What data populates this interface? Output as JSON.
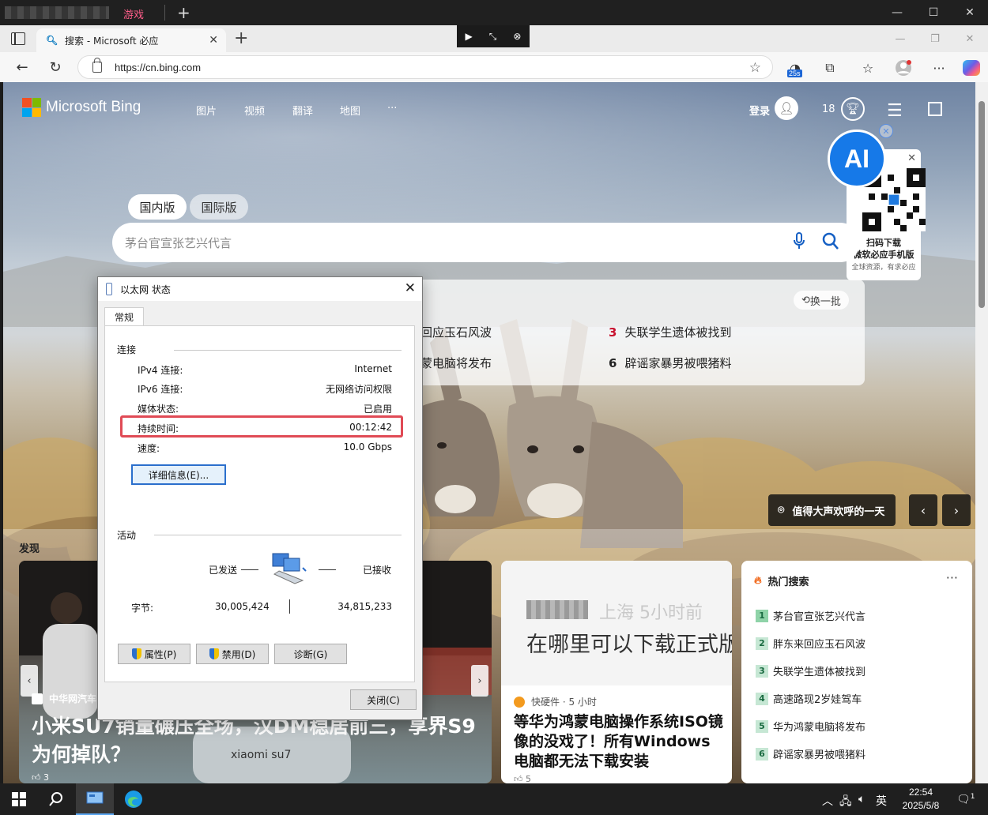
{
  "window": {
    "blurred_tab": "",
    "game_tab": "游戏"
  },
  "browser": {
    "tab_title": "搜索 - Microsoft 必应",
    "url": "https://cn.bing.com",
    "ext_badge": "25s"
  },
  "bing": {
    "brand": "Microsoft Bing",
    "nav": [
      "图片",
      "视频",
      "翻译",
      "地图",
      "···"
    ],
    "signin": "登录",
    "rewards": "18",
    "ai_badge": "AI",
    "qr_card": {
      "line1": "扫码下载",
      "line2": "微软必应手机版",
      "line3": "全球资源，有求必应"
    },
    "region_tabs": [
      "国内版",
      "国际版"
    ],
    "search_placeholder": "茅台官宣张艺兴代言",
    "trending_refresh": "换一批",
    "trending": [
      {
        "num": "",
        "text": "回应玉石风波"
      },
      {
        "num": "3",
        "text": "失联学生遗体被找到"
      },
      {
        "num": "",
        "text": "蒙电脑将发布"
      },
      {
        "num": "6",
        "text": "辟谣家暴男被喂猪料"
      }
    ],
    "caption": "值得大声欢呼的一天",
    "discover_label": "发现"
  },
  "cards": {
    "big": {
      "source": "中华网汽车",
      "headline": "小米SU7销量碾压全场，汉DM稳居前三，享界S9为何掉队？",
      "likes": "3"
    },
    "mid": {
      "meta": "上海 5小时前",
      "image_text": "在哪里可以下载正式版",
      "source": "快硬件 · 5 小时",
      "headline": "等华为鸿蒙电脑操作系统ISO镜像的没戏了！所有Windows电脑都无法下载安装",
      "likes": "5"
    },
    "hot": {
      "title": "热门搜索",
      "items": [
        {
          "n": "1",
          "text": "茅台官宣张艺兴代言"
        },
        {
          "n": "2",
          "text": "胖东来回应玉石风波"
        },
        {
          "n": "3",
          "text": "失联学生遗体被找到"
        },
        {
          "n": "4",
          "text": "高速路现2岁娃驾车"
        },
        {
          "n": "5",
          "text": "华为鸿蒙电脑将发布"
        },
        {
          "n": "6",
          "text": "辟谣家暴男被喂猪料"
        }
      ]
    }
  },
  "dialog": {
    "title": "以太网 状态",
    "tab": "常规",
    "group_connection": "连接",
    "rows": [
      {
        "label": "IPv4 连接:",
        "value": "Internet"
      },
      {
        "label": "IPv6 连接:",
        "value": "无网络访问权限"
      },
      {
        "label": "媒体状态:",
        "value": "已启用"
      },
      {
        "label": "持续时间:",
        "value": "00:12:42"
      },
      {
        "label": "速度:",
        "value": "10.0 Gbps"
      }
    ],
    "details_button": "详细信息(E)...",
    "group_activity": "活动",
    "sent_label": "已发送",
    "received_label": "已接收",
    "bytes_label": "字节:",
    "bytes_sent": "30,005,424",
    "bytes_received": "34,815,233",
    "properties_button": "属性(P)",
    "disable_button": "禁用(D)",
    "diagnose_button": "诊断(G)",
    "close_button": "关闭(C)"
  },
  "taskbar": {
    "ime": "英",
    "time": "22:54",
    "date": "2025/5/8",
    "notif_count": "1"
  }
}
